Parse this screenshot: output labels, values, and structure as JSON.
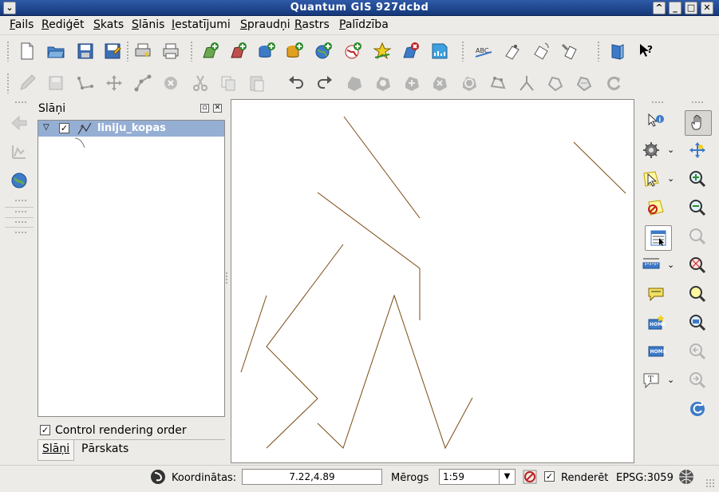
{
  "window": {
    "title": "Quantum GIS 927dcbd"
  },
  "menu": [
    "Fails",
    "Rediģēt",
    "Skats",
    "Slānis",
    "Iestatījumi",
    "Spraudņi",
    "Rastrs",
    "Palīdzība"
  ],
  "toolbar_file": [
    {
      "name": "new-project-icon"
    },
    {
      "name": "open-project-icon"
    },
    {
      "name": "save-project-icon"
    },
    {
      "name": "save-as-icon"
    },
    {
      "name": "print-composer-icon"
    },
    {
      "name": "print-icon"
    },
    {
      "name": "add-vector-layer-icon"
    },
    {
      "name": "add-raster-layer-icon"
    },
    {
      "name": "add-postgis-layer-icon"
    },
    {
      "name": "add-spatialite-layer-icon"
    },
    {
      "name": "add-wms-layer-icon"
    },
    {
      "name": "add-wfs-layer-icon"
    },
    {
      "name": "new-vector-layer-icon"
    },
    {
      "name": "remove-layer-icon"
    },
    {
      "name": "new-grid-icon"
    },
    {
      "name": "label-icon"
    },
    {
      "name": "move-label-icon"
    },
    {
      "name": "rotate-label-icon"
    },
    {
      "name": "change-label-icon"
    },
    {
      "name": "help-book-icon"
    },
    {
      "name": "whats-this-icon"
    }
  ],
  "toolbar_edit": [
    {
      "name": "toggle-editing-icon"
    },
    {
      "name": "save-edits-icon"
    },
    {
      "name": "capture-line-icon"
    },
    {
      "name": "move-feature-icon"
    },
    {
      "name": "node-tool-icon"
    },
    {
      "name": "delete-selected-icon"
    },
    {
      "name": "cut-features-icon"
    },
    {
      "name": "copy-features-icon"
    },
    {
      "name": "paste-features-icon"
    },
    {
      "name": "undo-icon"
    },
    {
      "name": "redo-icon"
    },
    {
      "name": "simplify-feature-icon"
    },
    {
      "name": "add-ring-icon"
    },
    {
      "name": "add-part-icon"
    },
    {
      "name": "delete-ring-icon"
    },
    {
      "name": "delete-part-icon"
    },
    {
      "name": "reshape-features-icon"
    },
    {
      "name": "split-features-icon"
    },
    {
      "name": "merge-features-icon"
    },
    {
      "name": "merge-attributes-icon"
    },
    {
      "name": "rotate-point-symbols-icon"
    }
  ],
  "layers_panel": {
    "title": "Slāņi",
    "layers": [
      {
        "name": "liniju_kopas",
        "checked": true
      }
    ],
    "control_rendering_order": "Control rendering order",
    "tabs": [
      "Slāņi",
      "Pārskats"
    ],
    "active_tab": 0
  },
  "canvas": {
    "line_color": "#7a4a10"
  },
  "status": {
    "coords_label": "Koordinātas:",
    "coords_value": "7.22,4.89",
    "scale_label": "Mērogs",
    "scale_value": "1:59",
    "render_label": "Renderēt",
    "crs": "EPSG:3059"
  }
}
